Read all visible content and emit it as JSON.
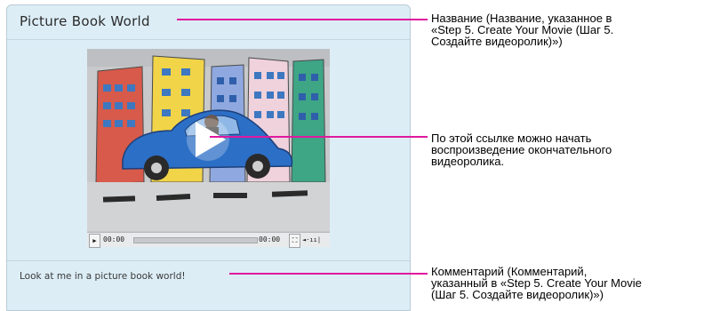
{
  "panel": {
    "title": "Picture Book World",
    "comment": "Look at me in a picture book world!"
  },
  "player": {
    "time_current": "00:00",
    "time_total": "00:00",
    "play_glyph": "▶",
    "fullscreen_glyph": "⛶",
    "volume_glyph": "◄·ıı|",
    "big_play_icon": "play-icon"
  },
  "annotations": [
    {
      "id": "title",
      "lines": [
        "Название (Название, указанное в",
        "«Step 5. Create Your Movie (Шаг 5.",
        "Создайте видеоролик)»)"
      ]
    },
    {
      "id": "play",
      "lines": [
        "По этой ссылке можно начать",
        "воспроизведение окончательного",
        "видеоролика."
      ]
    },
    {
      "id": "comment",
      "lines": [
        "Комментарий (Комментарий,",
        "указанный в «Step 5. Create Your Movie",
        "(Шаг 5. Создайте видеоролик)»)"
      ]
    }
  ],
  "colors": {
    "leader": "#e0199f",
    "panel_bg": "#dcedf6",
    "panel_border": "#b9cbd5"
  }
}
